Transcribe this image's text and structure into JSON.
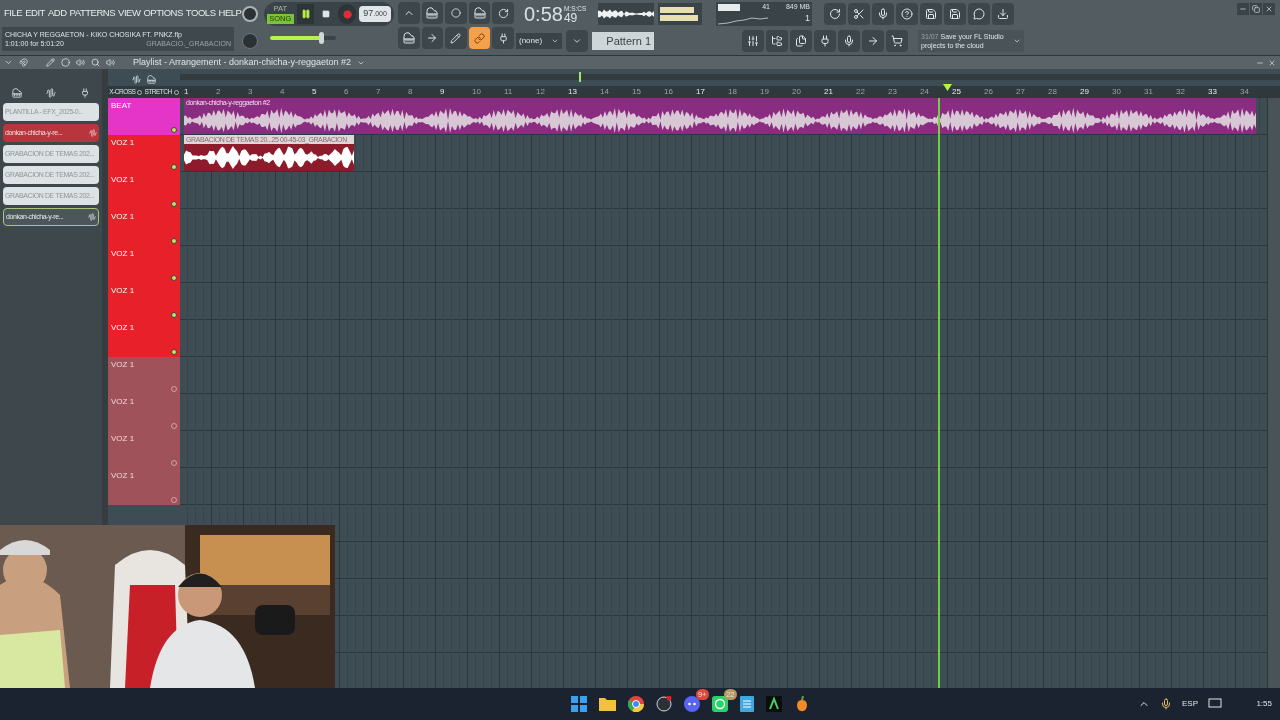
{
  "menu": [
    "FILE",
    "EDIT",
    "ADD",
    "PATTERNS",
    "VIEW",
    "OPTIONS",
    "TOOLS",
    "HELP"
  ],
  "song_info": {
    "title": "CHICHA Y REGGAETON - KIKO CHOSIKA FT. PNKZ.flp",
    "time": "1:01:00 for 5:01:20",
    "hint": "GRABACIO._GRABACION"
  },
  "transport": {
    "modes": [
      {
        "label": "PAT",
        "selected": false
      },
      {
        "label": "SONG",
        "selected": true
      }
    ],
    "playing": true,
    "recording": false,
    "tempo": "97",
    "tempo_decimals": ".000"
  },
  "master_volume": {
    "level": 0.78
  },
  "clock": {
    "time": "0:58",
    "sub": "49",
    "unit": "M:S:CS"
  },
  "monitor": {
    "cpu": "41",
    "memory": "849 MB",
    "polyphony": "1"
  },
  "pattern": {
    "snap": "(none)",
    "name": "Pattern 1"
  },
  "news": {
    "date": "31/07",
    "text": "Save your FL Studio projects to the cloud"
  },
  "playlist": {
    "title": "Playlist - Arrangement - donkan-chicha-y-reggaeton #2",
    "xcross": "X-CROSS",
    "stretch": "STRETCH"
  },
  "browser_items": [
    {
      "label": "PLANTILLA - EFX_2025-0...",
      "selected": false,
      "kind": "project"
    },
    {
      "label": "donkan-chicha-y-re...",
      "selected": true,
      "kind": "pattern"
    },
    {
      "label": "GRABACION DE TEMAS 202...",
      "selected": false,
      "kind": "audio"
    },
    {
      "label": "GRABACION DE TEMAS 202...",
      "selected": false,
      "kind": "audio"
    },
    {
      "label": "GRABACION DE TEMAS 202...",
      "selected": false,
      "kind": "audio"
    },
    {
      "label": "donkan-chicha-y-re...",
      "selected": false,
      "kind": "pattern"
    }
  ],
  "ruler": [
    "1",
    "2",
    "3",
    "4",
    "5",
    "6",
    "7",
    "8",
    "9",
    "10",
    "11",
    "12",
    "13",
    "14",
    "15",
    "16",
    "17",
    "18",
    "19",
    "20",
    "21",
    "22",
    "23",
    "24",
    "25",
    "26",
    "27",
    "28",
    "29",
    "30",
    "31",
    "32",
    "33",
    "34"
  ],
  "playhead": {
    "level": 0.697
  },
  "tracks": [
    {
      "name": "BEAT",
      "color": "#e535c8",
      "kind": "used"
    },
    {
      "name": "VOZ 1",
      "color": "#e8202a",
      "kind": "used"
    },
    {
      "name": "VOZ 1",
      "color": "#e8202a",
      "kind": "used"
    },
    {
      "name": "VOZ 1",
      "color": "#e8202a",
      "kind": "used"
    },
    {
      "name": "VOZ 1",
      "color": "#e8202a",
      "kind": "used"
    },
    {
      "name": "VOZ 1",
      "color": "#e8202a",
      "kind": "used"
    },
    {
      "name": "VOZ 1",
      "color": "#e8202a",
      "kind": "used"
    },
    {
      "name": "VOZ 1",
      "color": "#a0525a",
      "kind": "empty"
    },
    {
      "name": "VOZ 1",
      "color": "#a0525a",
      "kind": "empty"
    },
    {
      "name": "VOZ 1",
      "color": "#a0525a",
      "kind": "empty"
    },
    {
      "name": "VOZ 1",
      "color": "#a0525a",
      "kind": "empty"
    }
  ],
  "clips": [
    {
      "label": "donkan-chicha-y-reggaeton #2",
      "kind": "pattern"
    },
    {
      "label": "GRABACION DE TEMAS 20...25 00-45-03_GRABACION",
      "kind": "audio"
    }
  ],
  "taskbar": {
    "badges": [
      "9+",
      "22"
    ],
    "language": "ESP",
    "time": "1:55"
  }
}
